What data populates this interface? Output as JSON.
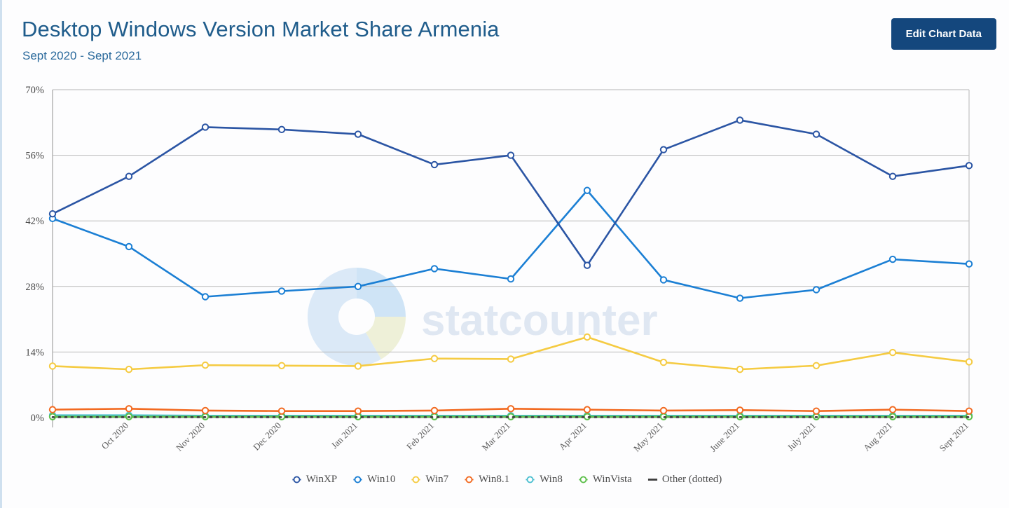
{
  "header": {
    "title": "Desktop Windows Version Market Share Armenia",
    "subtitle": "Sept 2020 - Sept 2021",
    "edit_button_label": "Edit Chart Data",
    "title_color": "#1f5c8b",
    "button_bg": "#14477d",
    "button_text_color": "#ffffff"
  },
  "watermark": {
    "text": "statcounter",
    "text_color": "#dfe7f2"
  },
  "chart_data": {
    "type": "line",
    "title": "Desktop Windows Version Market Share Armenia",
    "subtitle": "Sept 2020 - Sept 2021",
    "xlabel": "",
    "ylabel": "",
    "ylim": [
      0,
      70
    ],
    "yticks": [
      0,
      14,
      28,
      42,
      56,
      70
    ],
    "ytick_labels": [
      "0%",
      "14%",
      "28%",
      "42%",
      "56%",
      "70%"
    ],
    "grid": true,
    "legend_position": "bottom",
    "categories": [
      "Sept 2020",
      "Oct 2020",
      "Nov 2020",
      "Dec 2020",
      "Jan 2021",
      "Feb 2021",
      "Mar 2021",
      "Apr 2021",
      "May 2021",
      "June 2021",
      "July 2021",
      "Aug 2021",
      "Sept 2021"
    ],
    "xtick_labels": [
      "",
      "Oct 2020",
      "Nov 2020",
      "Dec 2020",
      "Jan 2021",
      "Feb 2021",
      "Mar 2021",
      "Apr 2021",
      "May 2021",
      "June 2021",
      "July 2021",
      "Aug 2021",
      "Sept 2021"
    ],
    "series": [
      {
        "name": "WinXP",
        "color": "#2b55a4",
        "style": "solid",
        "values": [
          43.5,
          51.5,
          62.0,
          61.5,
          60.5,
          54.0,
          56.0,
          32.5,
          57.2,
          63.5,
          60.5,
          51.5,
          53.8
        ]
      },
      {
        "name": "Win10",
        "color": "#1b7fd4",
        "style": "solid",
        "values": [
          42.5,
          36.5,
          25.8,
          27.0,
          28.0,
          31.8,
          29.6,
          48.5,
          29.4,
          25.5,
          27.3,
          33.8,
          32.8
        ]
      },
      {
        "name": "Win7",
        "color": "#f5cb42",
        "style": "solid",
        "values": [
          11.0,
          10.3,
          11.2,
          11.1,
          11.0,
          12.6,
          12.5,
          17.2,
          11.8,
          10.3,
          11.1,
          13.9,
          11.9
        ]
      },
      {
        "name": "Win8.1",
        "color": "#f26a21",
        "style": "solid",
        "values": [
          1.7,
          1.9,
          1.5,
          1.4,
          1.4,
          1.5,
          1.9,
          1.7,
          1.5,
          1.6,
          1.4,
          1.7,
          1.4
        ]
      },
      {
        "name": "Win8",
        "color": "#4bbfd0",
        "style": "solid",
        "values": [
          0.5,
          0.5,
          0.4,
          0.4,
          0.4,
          0.4,
          0.4,
          0.4,
          0.4,
          0.4,
          0.4,
          0.4,
          0.4
        ]
      },
      {
        "name": "WinVista",
        "color": "#5cbf4a",
        "style": "solid",
        "values": [
          0.2,
          0.2,
          0.2,
          0.2,
          0.2,
          0.2,
          0.2,
          0.2,
          0.2,
          0.2,
          0.2,
          0.2,
          0.2
        ]
      },
      {
        "name": "Other (dotted)",
        "color": "#3c3c3c",
        "style": "dotted",
        "values": [
          0.1,
          0.1,
          0.1,
          0.1,
          0.1,
          0.1,
          0.1,
          0.1,
          0.1,
          0.1,
          0.1,
          0.1,
          0.1
        ]
      }
    ]
  },
  "legend": [
    {
      "label": "WinXP",
      "color": "#2b55a4",
      "marker": "circle"
    },
    {
      "label": "Win10",
      "color": "#1b7fd4",
      "marker": "circle"
    },
    {
      "label": "Win7",
      "color": "#f5cb42",
      "marker": "circle"
    },
    {
      "label": "Win8.1",
      "color": "#f26a21",
      "marker": "circle"
    },
    {
      "label": "Win8",
      "color": "#4bbfd0",
      "marker": "circle"
    },
    {
      "label": "WinVista",
      "color": "#5cbf4a",
      "marker": "circle"
    },
    {
      "label": "Other (dotted)",
      "color": "#3c3c3c",
      "marker": "line"
    }
  ]
}
